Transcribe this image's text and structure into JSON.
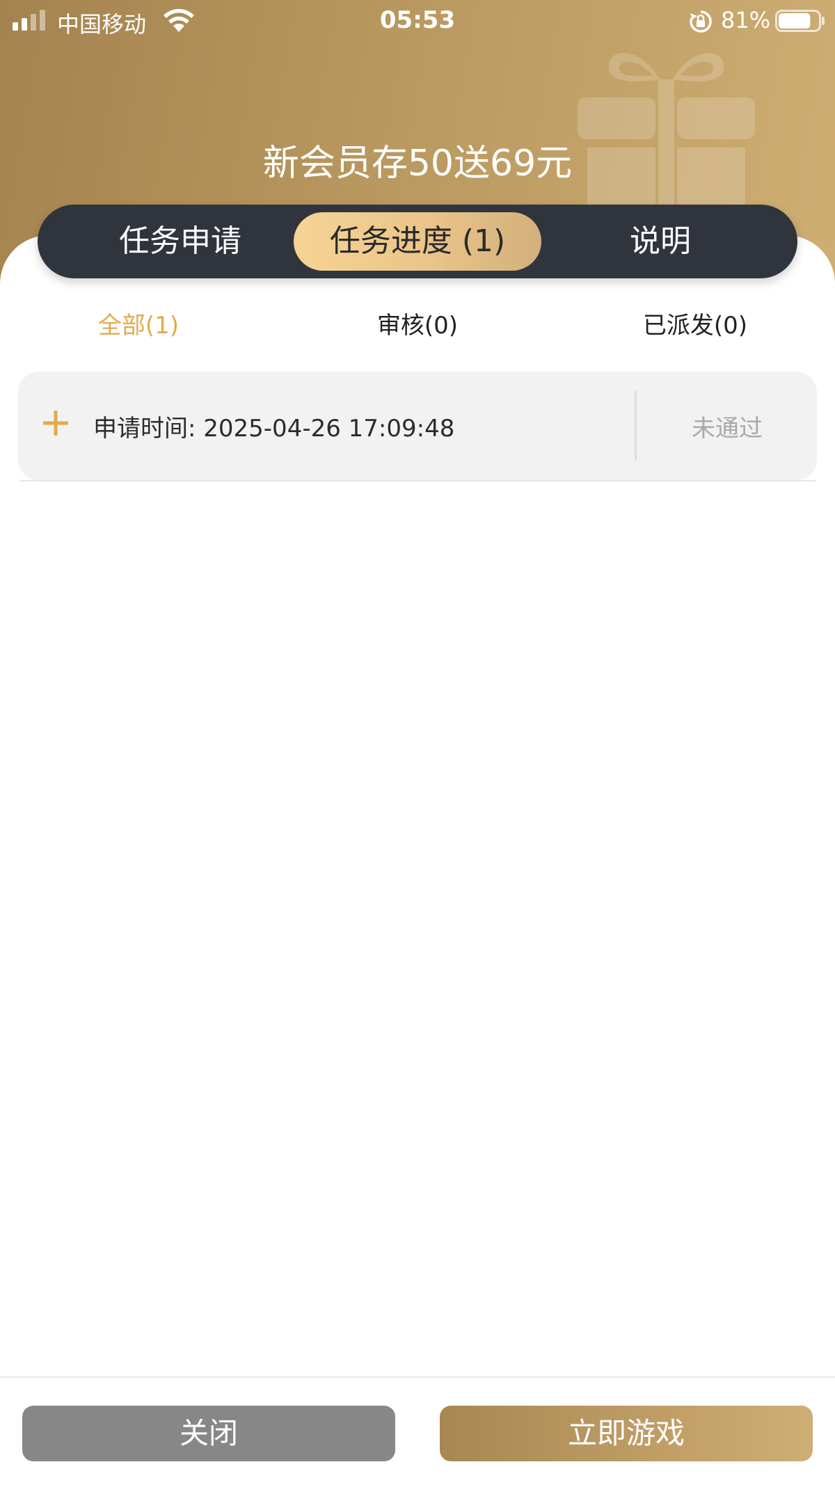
{
  "status_bar": {
    "carrier": "中国移动",
    "time": "05:53",
    "battery_percent": "81%",
    "battery_level": 0.81
  },
  "header": {
    "title": "新会员存50送69元"
  },
  "main_tabs": [
    {
      "label": "任务申请",
      "active": false
    },
    {
      "label": "任务进度 (1)",
      "active": true
    },
    {
      "label": "说明",
      "active": false
    }
  ],
  "sub_tabs": [
    {
      "label": "全部(1)",
      "active": true
    },
    {
      "label": "审核(0)",
      "active": false
    },
    {
      "label": "已派发(0)",
      "active": false
    }
  ],
  "records": [
    {
      "apply_time": "申请时间: 2025-04-26 17:09:48",
      "status": "未通过"
    }
  ],
  "footer": {
    "close_label": "关闭",
    "play_label": "立即游戏"
  },
  "colors": {
    "accent": "#e2aa4c",
    "header_gradient_start": "#a4834f",
    "header_gradient_end": "#cfae74",
    "tab_bar": "#30353d"
  }
}
